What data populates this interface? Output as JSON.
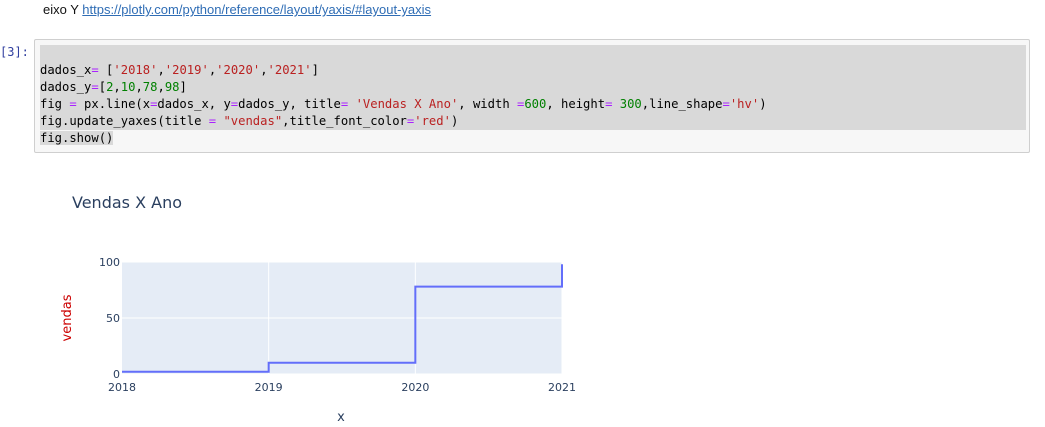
{
  "markdown": {
    "prefix": "eixo Y ",
    "link_text": "https://plotly.com/python/reference/layout/yaxis/#layout-yaxis"
  },
  "cell": {
    "prompt": "[3]:",
    "code_lines": [
      "",
      "dados_x= ['2018','2019','2020','2021']",
      "dados_y=[2,10,78,98]",
      "fig = px.line(x=dados_x, y=dados_y, title= 'Vendas X Ano', width =600, height= 300,line_shape='hv')",
      "fig.update_yaxes(title = \"vendas\",title_font_color='red')",
      "fig.show()"
    ]
  },
  "chart_data": {
    "type": "line",
    "line_shape": "hv",
    "title": "Vendas X Ano",
    "xlabel": "x",
    "ylabel": "vendas",
    "ylabel_color": "#cc0000",
    "x": [
      "2018",
      "2019",
      "2020",
      "2021"
    ],
    "series": [
      {
        "values": [
          2,
          10,
          78,
          98
        ],
        "color": "#636efa"
      }
    ],
    "y_ticks": [
      "0",
      "50",
      "100"
    ],
    "x_ticks": [
      "2018",
      "2019",
      "2020",
      "2021"
    ],
    "ylim": [
      0,
      100
    ],
    "grid": true,
    "plot_bg": "#e5ecf6"
  }
}
